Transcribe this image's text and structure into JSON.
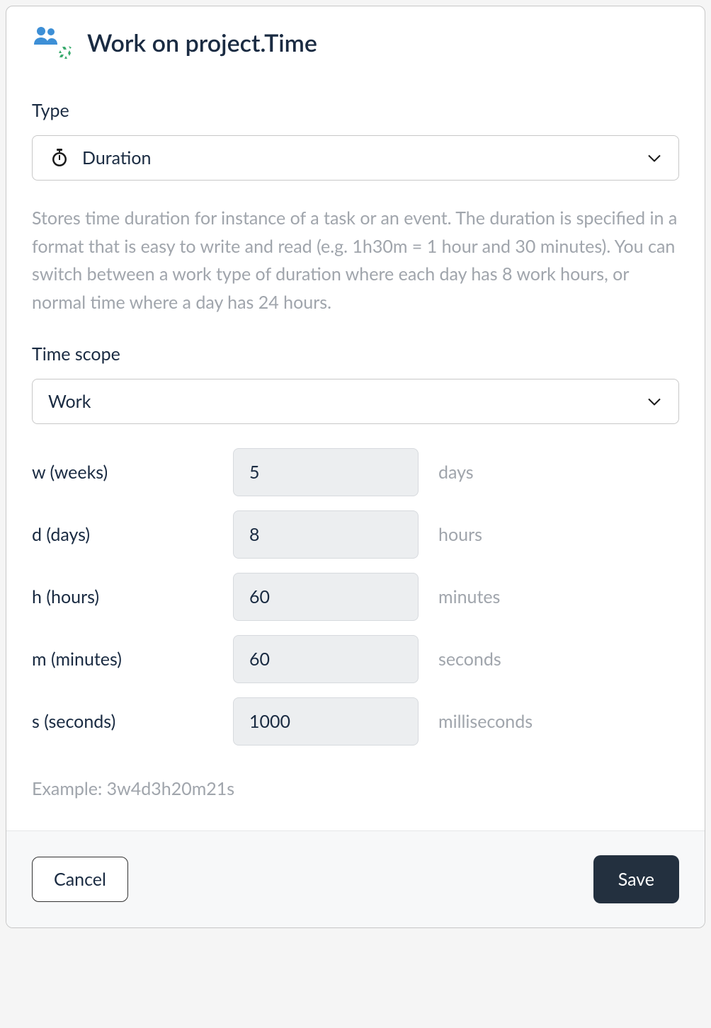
{
  "header": {
    "title": "Work on project.Time"
  },
  "type_field": {
    "label": "Type",
    "value": "Duration",
    "help": "Stores time duration for instance of a task or an event. The duration is specified in a format that is easy to write and read (e.g. 1h30m = 1 hour and 30 minutes). You can switch between a work type of duration where each day has 8 work hours, or normal time where a day has 24 hours."
  },
  "time_scope": {
    "label": "Time scope",
    "value": "Work"
  },
  "units": [
    {
      "label": "w (weeks)",
      "value": "5",
      "suffix": "days"
    },
    {
      "label": "d (days)",
      "value": "8",
      "suffix": "hours"
    },
    {
      "label": "h (hours)",
      "value": "60",
      "suffix": "minutes"
    },
    {
      "label": "m (minutes)",
      "value": "60",
      "suffix": "seconds"
    },
    {
      "label": "s (seconds)",
      "value": "1000",
      "suffix": "milliseconds"
    }
  ],
  "example": "Example: 3w4d3h20m21s",
  "footer": {
    "cancel": "Cancel",
    "save": "Save"
  }
}
